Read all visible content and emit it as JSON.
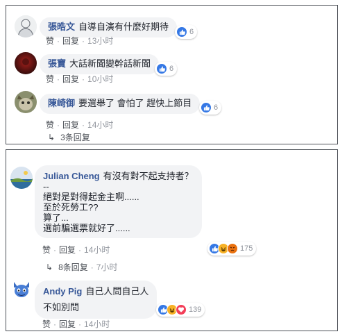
{
  "colors": {
    "link": "#385898",
    "like": "#3578e5",
    "haha": "#f7b125",
    "love": "#f33e58",
    "meta": "#90949c"
  },
  "panel1": {
    "comments": [
      {
        "name": "張晧文",
        "text": "自導自演有什麼好期待",
        "like": "赞",
        "reply": "回复",
        "time": "13小时",
        "reactions": [
          "like-icon"
        ],
        "count": "6",
        "avatar": "avatar-sketch"
      },
      {
        "name": "張寶",
        "text": "大話新聞變幹話新聞",
        "like": "赞",
        "reply": "回复",
        "time": "10小时",
        "reactions": [
          "like-icon"
        ],
        "count": "6",
        "avatar": "avatar-dark-red"
      },
      {
        "name": "陳崎御",
        "text": "要選舉了 會怕了 趕快上節目",
        "like": "赞",
        "reply": "回复",
        "time": "14小时",
        "reactions": [
          "like-icon"
        ],
        "count": "6",
        "avatar": "avatar-animal"
      }
    ],
    "replies_link": "3条回复"
  },
  "panel2": {
    "comments": [
      {
        "name": "Julian Cheng",
        "lines": [
          "有沒有對不起支持者？",
          "--",
          "絕對是對得起金主啊......",
          "至於死勞工??",
          "算了...",
          "選前騙選票就好了......"
        ],
        "like": "赞",
        "reply": "回复",
        "time": "14小时",
        "reactions": [
          "like-icon",
          "haha-icon",
          "angry-icon"
        ],
        "count": "175",
        "avatar": "avatar-landscape"
      },
      {
        "name": "Andy Pig",
        "lines": [
          "自己人問自己人",
          "不如別問"
        ],
        "like": "赞",
        "reply": "回复",
        "time": "14小时",
        "reactions": [
          "like-icon",
          "haha-icon",
          "love-icon"
        ],
        "count": "139",
        "avatar": "avatar-cartoon"
      }
    ],
    "replies": {
      "label": "8条回复",
      "time": "7小时"
    }
  }
}
